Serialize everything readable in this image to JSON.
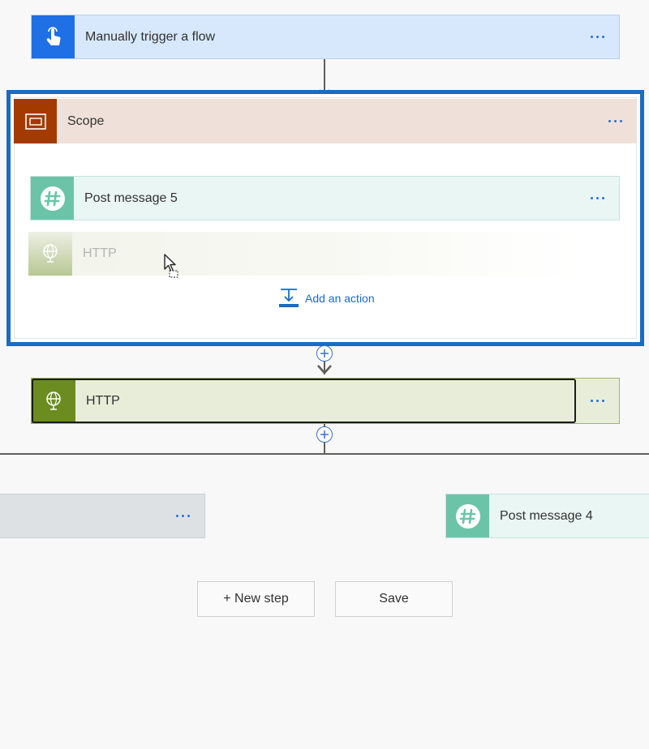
{
  "trigger": {
    "label": "Manually trigger a flow",
    "icon": "touch-hand-icon",
    "color": "#1f6fe5"
  },
  "scope": {
    "label": "Scope",
    "icon": "scope-icon",
    "color": "#a33b00",
    "actions": [
      {
        "label": "Post message 5",
        "icon": "slack-hash-icon",
        "color": "#6cc4a8"
      }
    ],
    "dragging_ghost": {
      "label": "HTTP",
      "icon": "globe-icon"
    },
    "add_action_label": "Add an action"
  },
  "http": {
    "label": "HTTP",
    "icon": "globe-icon",
    "color": "#6b8d1f"
  },
  "branches": {
    "right_label": "Post message 4",
    "right_icon": "slack-hash-icon"
  },
  "footer": {
    "new_step_label": "+ New step",
    "save_label": "Save"
  }
}
